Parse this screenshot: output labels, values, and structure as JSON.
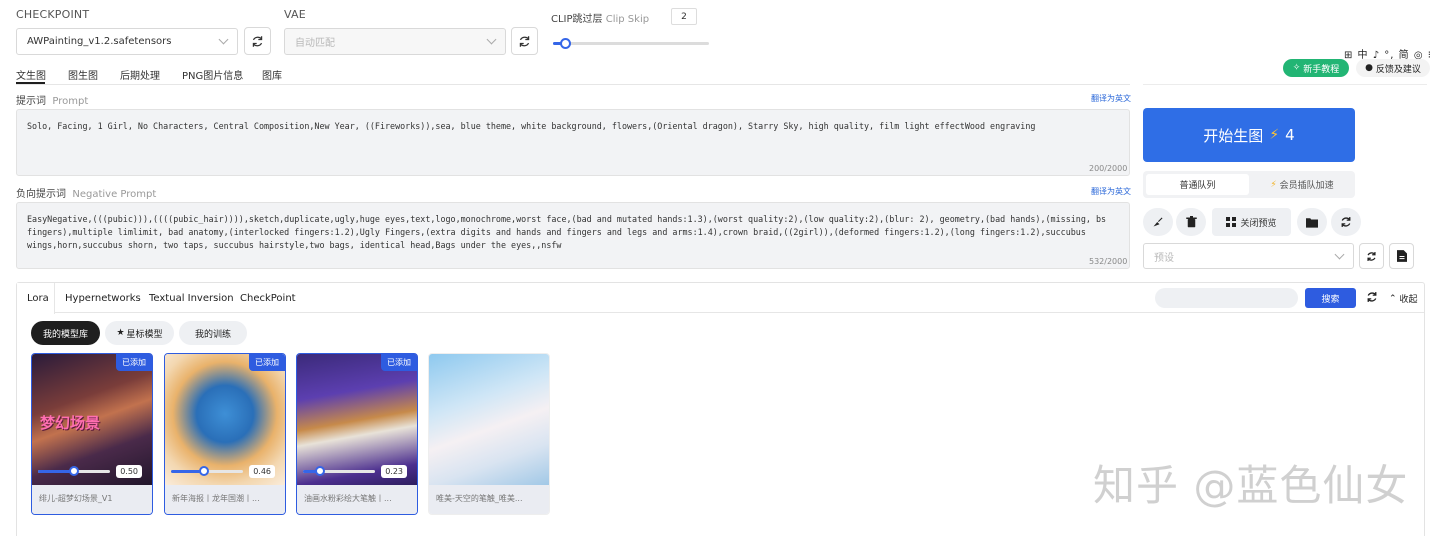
{
  "checkpoint": {
    "label": "CHECKPOINT",
    "value": "AWPainting_v1.2.safetensors"
  },
  "vae": {
    "label": "VAE",
    "placeholder": "自动匹配"
  },
  "clip": {
    "label_cn": "CLIP跳过层",
    "label_en": "Clip Skip",
    "value": "2",
    "level": 0.08
  },
  "top_icons": {
    "text": "⊞ 中 ♪ °, 简 ◎ ⁝"
  },
  "tabs": [
    "文生图",
    "图生图",
    "后期处理",
    "PNG图片信息",
    "图库"
  ],
  "tutorial_button": "新手教程",
  "feedback_button": "反馈及建议",
  "prompt": {
    "label_cn": "提示词",
    "label_en": "Prompt",
    "translate": "翻译为英文",
    "text": "Solo, Facing, 1 Girl, No Characters, Central Composition,New Year, ((Fireworks)),sea, blue theme, white background, flowers,(Oriental dragon), Starry Sky, high quality, film light effectWood engraving",
    "counter": "200/2000"
  },
  "negative": {
    "label_cn": "负向提示词",
    "label_en": "Negative Prompt",
    "translate": "翻译为英文",
    "text": "EasyNegative,(((pubic))),((((pubic_hair)))),sketch,duplicate,ugly,huge eyes,text,logo,monochrome,worst face,(bad and mutated hands:1.3),(worst quality:2),(low quality:2),(blur: 2), geometry,(bad hands),(missing, bs fingers),multiple limlimit, bad anatomy,(interlocked fingers:1.2),Ugly Fingers,(extra digits and hands and fingers and legs and arms:1.4),crown braid,((2girl)),(deformed fingers:1.2),(long fingers:1.2),succubus wings,horn,succubus shorn, two taps, succubus hairstyle,two bags, identical head,Bags under the eyes,,nsfw",
    "counter": "532/2000"
  },
  "generate": {
    "label": "开始生图",
    "count": "4"
  },
  "queue": {
    "normal": "普通队列",
    "vip": "会员插队加速"
  },
  "preview_toggle": "关闭预览",
  "preset": {
    "placeholder": "预设"
  },
  "lower_tabs": [
    "Lora",
    "Hypernetworks",
    "Textual Inversion",
    "CheckPoint"
  ],
  "search_button": "搜索",
  "collapse_button": "收起",
  "filters": [
    "我的模型库",
    "星标模型",
    "我的训练"
  ],
  "cards": [
    {
      "badge": "已添加",
      "weight": "0.50",
      "level": 0.5,
      "caption": "绯儿-超梦幻场景_V1",
      "overlay": "梦幻场景"
    },
    {
      "badge": "已添加",
      "weight": "0.46",
      "level": 0.46,
      "caption": "新年海报丨龙年国潮丨..."
    },
    {
      "badge": "已添加",
      "weight": "0.23",
      "level": 0.23,
      "caption": "油画水粉彩绘大笔触丨..."
    },
    {
      "caption": "唯美-天空的笔触_唯美..."
    }
  ],
  "watermark": "知乎 @蓝色仙女",
  "colors": {
    "primary": "#2e5ce0",
    "generate": "#2f6ee6",
    "green": "#22b574",
    "dark_pill": "#1f1f1f"
  }
}
